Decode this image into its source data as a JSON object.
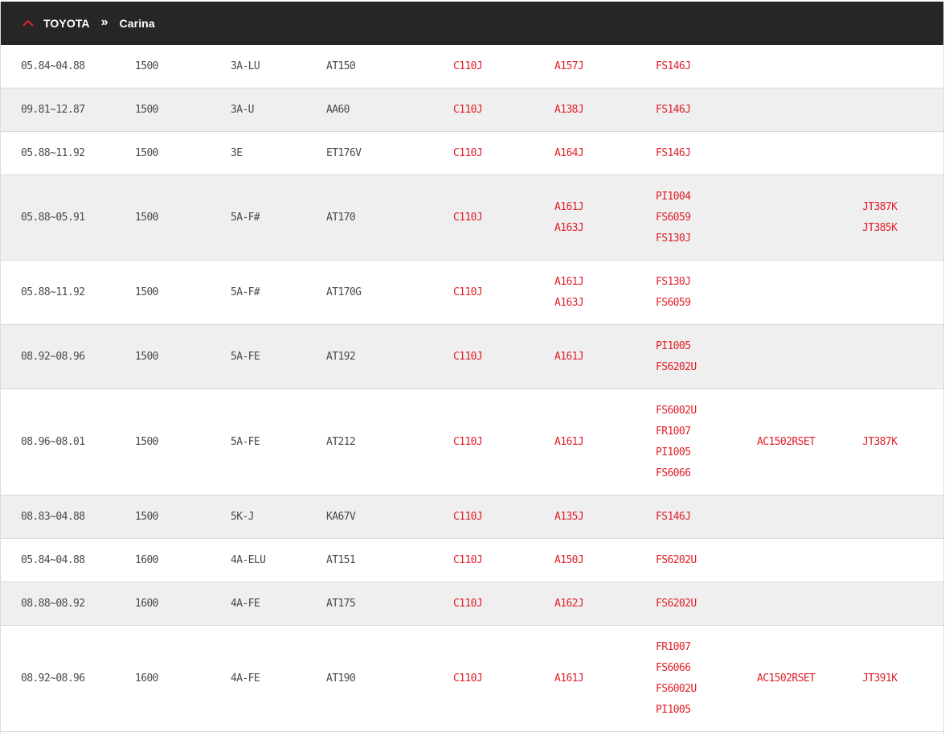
{
  "header": {
    "brand": "TOYOTA",
    "separator": "»",
    "model": "Carina",
    "caret_icon": "chevron-up-icon",
    "accent": "#e0202a",
    "bg": "#262626"
  },
  "rows": [
    {
      "date": "05.84~04.88",
      "cc": "1500",
      "engine": "3A-LU",
      "model": "AT150",
      "p1": [
        "C110J"
      ],
      "p2": [
        "A157J"
      ],
      "p3": [
        "FS146J"
      ],
      "p4": [],
      "p5": []
    },
    {
      "date": "09.81~12.87",
      "cc": "1500",
      "engine": "3A-U",
      "model": "AA60",
      "p1": [
        "C110J"
      ],
      "p2": [
        "A138J"
      ],
      "p3": [
        "FS146J"
      ],
      "p4": [],
      "p5": []
    },
    {
      "date": "05.88~11.92",
      "cc": "1500",
      "engine": "3E",
      "model": "ET176V",
      "p1": [
        "C110J"
      ],
      "p2": [
        "A164J"
      ],
      "p3": [
        "FS146J"
      ],
      "p4": [],
      "p5": []
    },
    {
      "date": "05.88~05.91",
      "cc": "1500",
      "engine": "5A-F#",
      "model": "AT170",
      "p1": [
        "C110J"
      ],
      "p2": [
        "A161J",
        "A163J"
      ],
      "p3": [
        "PI1004",
        "FS6059",
        "FS130J"
      ],
      "p4": [],
      "p5": [
        "JT387K",
        "JT385K"
      ]
    },
    {
      "date": "05.88~11.92",
      "cc": "1500",
      "engine": "5A-F#",
      "model": "AT170G",
      "p1": [
        "C110J"
      ],
      "p2": [
        "A161J",
        "A163J"
      ],
      "p3": [
        "FS130J",
        "FS6059"
      ],
      "p4": [],
      "p5": []
    },
    {
      "date": "08.92~08.96",
      "cc": "1500",
      "engine": "5A-FE",
      "model": "AT192",
      "p1": [
        "C110J"
      ],
      "p2": [
        "A161J"
      ],
      "p3": [
        "PI1005",
        "FS6202U"
      ],
      "p4": [],
      "p5": []
    },
    {
      "date": "08.96~08.01",
      "cc": "1500",
      "engine": "5A-FE",
      "model": "AT212",
      "p1": [
        "C110J"
      ],
      "p2": [
        "A161J"
      ],
      "p3": [
        "FS6002U",
        "FR1007",
        "PI1005",
        "FS6066"
      ],
      "p4": [
        "AC1502RSET"
      ],
      "p5": [
        "JT387K"
      ]
    },
    {
      "date": "08.83~04.88",
      "cc": "1500",
      "engine": "5K-J",
      "model": "KA67V",
      "p1": [
        "C110J"
      ],
      "p2": [
        "A135J"
      ],
      "p3": [
        "FS146J"
      ],
      "p4": [],
      "p5": []
    },
    {
      "date": "05.84~04.88",
      "cc": "1600",
      "engine": "4A-ELU",
      "model": "AT151",
      "p1": [
        "C110J"
      ],
      "p2": [
        "A150J"
      ],
      "p3": [
        "FS6202U"
      ],
      "p4": [],
      "p5": []
    },
    {
      "date": "08.88~08.92",
      "cc": "1600",
      "engine": "4A-FE",
      "model": "AT175",
      "p1": [
        "C110J"
      ],
      "p2": [
        "A162J"
      ],
      "p3": [
        "FS6202U"
      ],
      "p4": [],
      "p5": []
    },
    {
      "date": "08.92~08.96",
      "cc": "1600",
      "engine": "4A-FE",
      "model": "AT190",
      "p1": [
        "C110J"
      ],
      "p2": [
        "A161J"
      ],
      "p3": [
        "FR1007",
        "FS6066",
        "FS6002U",
        "PI1005"
      ],
      "p4": [
        "AC1502RSET"
      ],
      "p5": [
        "JT391K"
      ]
    }
  ]
}
